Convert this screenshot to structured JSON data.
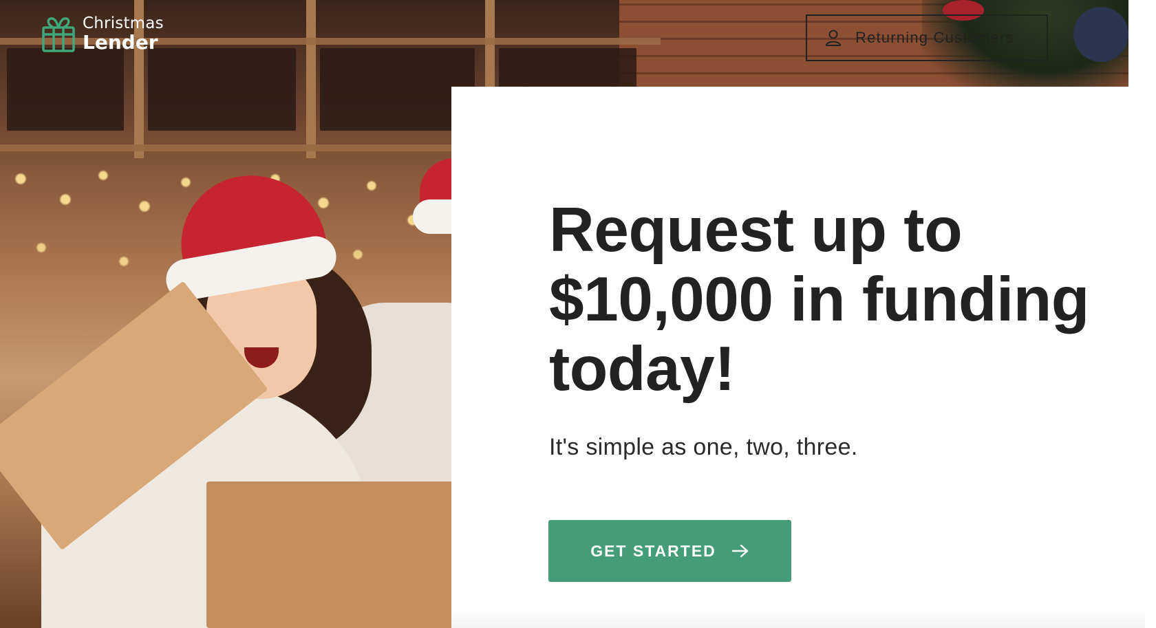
{
  "brand": {
    "name_line1": "Christmas",
    "name_line2": "Lender",
    "logo_icon": "gift-icon",
    "accent_color": "#3fa77a"
  },
  "header": {
    "returning_customers_label": "Returning Customers",
    "returning_customers_icon": "user-icon"
  },
  "hero": {
    "headline": "Request up to $10,000 in funding today!",
    "subheadline": "It's simple as one, two, three.",
    "cta_label": "GET STARTED",
    "cta_icon": "arrow-right-icon",
    "cta_color": "#459c79",
    "image_alt": "Woman in a Santa hat opening a gift box"
  }
}
